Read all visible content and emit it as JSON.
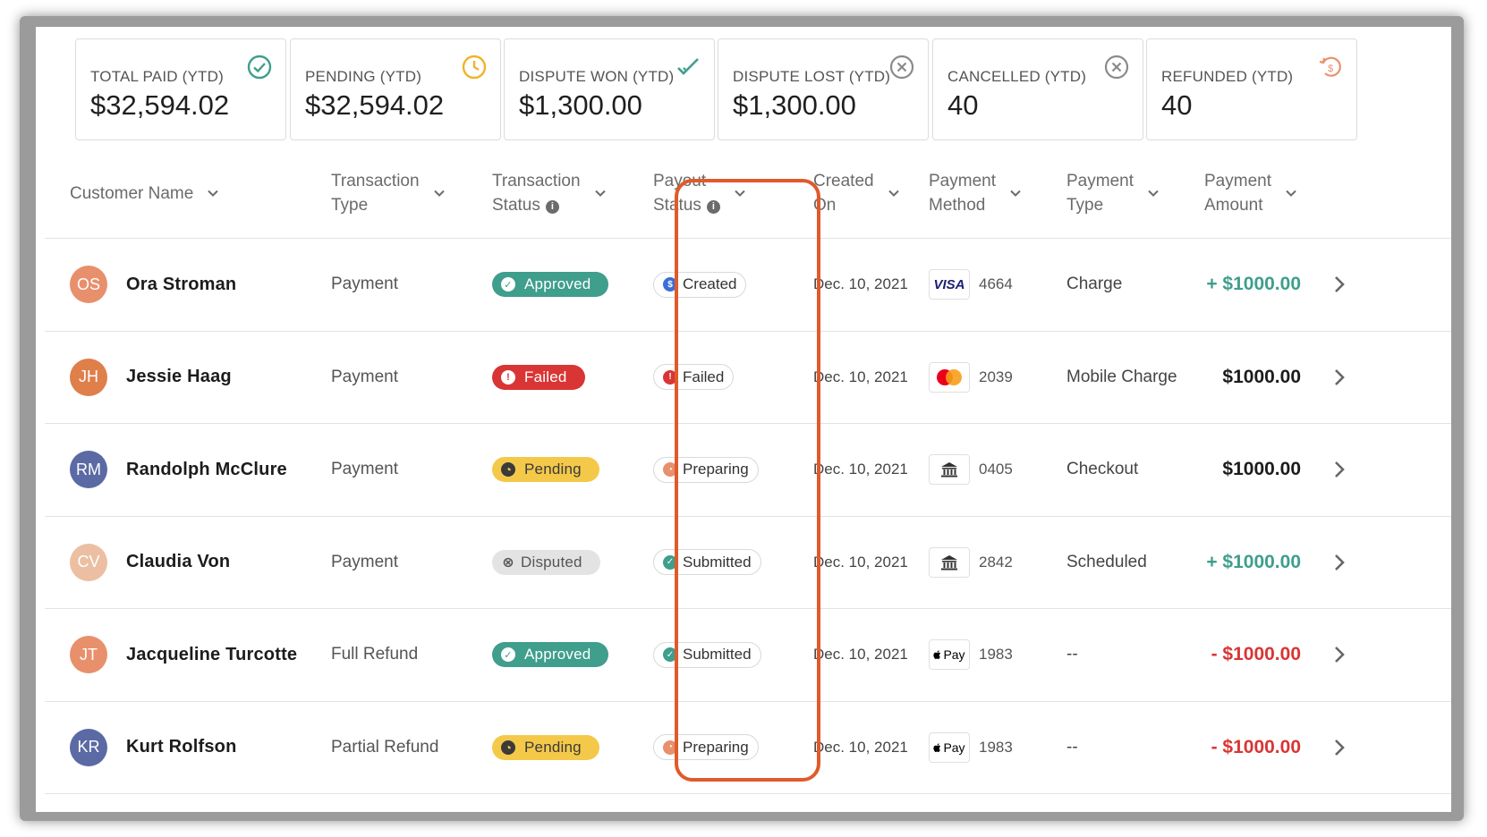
{
  "colors": {
    "approved": "#3f9e8c",
    "failed": "#d93535",
    "pending": "#f4c94a",
    "disputed": "#e3e3e3",
    "positive_amount": "#3f9e8c",
    "negative_amount": "#d93535",
    "highlight": "#e05a2b"
  },
  "summary": [
    {
      "label": "TOTAL PAID (YTD)",
      "value": "$32,594.02",
      "icon": "check-circle-icon"
    },
    {
      "label": "PENDING (YTD)",
      "value": "$32,594.02",
      "icon": "clock-icon"
    },
    {
      "label": "DISPUTE WON (YTD)",
      "value": "$1,300.00",
      "icon": "double-check-icon"
    },
    {
      "label": "DISPUTE LOST (YTD)",
      "value": "$1,300.00",
      "icon": "x-circle-icon"
    },
    {
      "label": "CANCELLED (YTD)",
      "value": "40",
      "icon": "x-circle-icon"
    },
    {
      "label": "REFUNDED (YTD)",
      "value": "40",
      "icon": "refund-icon"
    }
  ],
  "columns": {
    "customer_name": "Customer Name",
    "transaction_type": [
      "Transaction",
      "Type"
    ],
    "transaction_status": [
      "Transaction",
      "Status"
    ],
    "payout_status": [
      "Payout",
      "Status"
    ],
    "created_on": [
      "Created",
      "On"
    ],
    "payment_method": [
      "Payment",
      "Method"
    ],
    "payment_type": [
      "Payment",
      "Type"
    ],
    "payment_amount": [
      "Payment",
      "Amount"
    ]
  },
  "rows": [
    {
      "initials": "OS",
      "avatar_color": "#e8906c",
      "name": "Ora Stroman",
      "type": "Payment",
      "status": "Approved",
      "status_kind": "approved",
      "payout": "Created",
      "payout_kind": "created",
      "date": "Dec. 10, 2021",
      "method_icon": "visa-icon",
      "method_last4": "4664",
      "payment_type": "Charge",
      "amount": "+ $1000.00",
      "amount_kind": "positive"
    },
    {
      "initials": "JH",
      "avatar_color": "#df7f4a",
      "name": "Jessie Haag",
      "type": "Payment",
      "status": "Failed",
      "status_kind": "failed",
      "payout": "Failed",
      "payout_kind": "failed",
      "date": "Dec. 10, 2021",
      "method_icon": "mastercard-icon",
      "method_last4": "2039",
      "payment_type": "Mobile Charge",
      "amount": "$1000.00",
      "amount_kind": "neutral"
    },
    {
      "initials": "RM",
      "avatar_color": "#5b6aa4",
      "name": "Randolph McClure",
      "type": "Payment",
      "status": "Pending",
      "status_kind": "pending",
      "payout": "Preparing",
      "payout_kind": "preparing",
      "date": "Dec. 10, 2021",
      "method_icon": "bank-icon",
      "method_last4": "0405",
      "payment_type": "Checkout",
      "amount": "$1000.00",
      "amount_kind": "neutral"
    },
    {
      "initials": "CV",
      "avatar_color": "#ecbfa3",
      "name": "Claudia Von",
      "type": "Payment",
      "status": "Disputed",
      "status_kind": "disputed",
      "payout": "Submitted",
      "payout_kind": "submitted",
      "date": "Dec. 10, 2021",
      "method_icon": "bank-icon",
      "method_last4": "2842",
      "payment_type": "Scheduled",
      "amount": "+ $1000.00",
      "amount_kind": "positive"
    },
    {
      "initials": "JT",
      "avatar_color": "#e8906c",
      "name": "Jacqueline Turcotte",
      "type": "Full Refund",
      "status": "Approved",
      "status_kind": "approved",
      "payout": "Submitted",
      "payout_kind": "submitted",
      "date": "Dec. 10, 2021",
      "method_icon": "apple-pay-icon",
      "method_last4": "1983",
      "payment_type": "--",
      "amount": "- $1000.00",
      "amount_kind": "negative"
    },
    {
      "initials": "KR",
      "avatar_color": "#5b6aa4",
      "name": "Kurt Rolfson",
      "type": "Partial Refund",
      "status": "Pending",
      "status_kind": "pending",
      "payout": "Preparing",
      "payout_kind": "preparing",
      "date": "Dec. 10, 2021",
      "method_icon": "apple-pay-icon",
      "method_last4": "1983",
      "payment_type": "--",
      "amount": "- $1000.00",
      "amount_kind": "negative"
    }
  ],
  "apple_pay_text": "Pay",
  "visa_text": "VISA"
}
